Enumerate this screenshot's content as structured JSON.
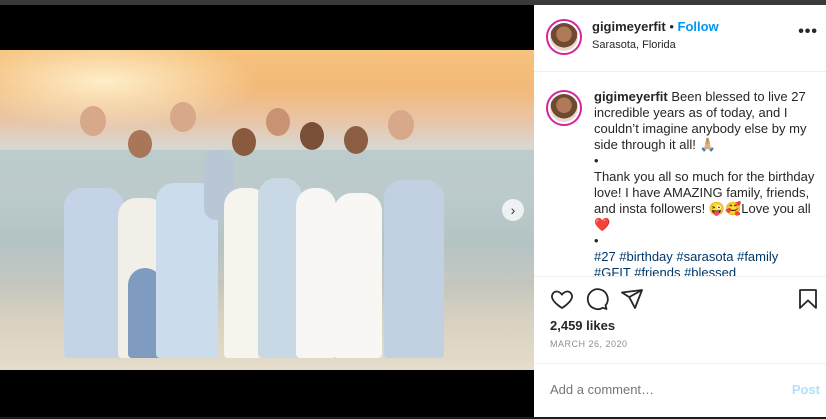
{
  "post": {
    "username": "gigimeyerfit",
    "separator": "•",
    "follow_label": "Follow",
    "location": "Sarasota, Florida",
    "more_label": "•••",
    "caption": {
      "username": "gigimeyerfit",
      "line1": "Been blessed to live 27 incredible years as of today, and I couldn’t imagine anybody else by my side through it all! 🙏🏼",
      "bullet1": "•",
      "line2": "Thank you all so much for the birthday love! I have AMAZING family, friends, and insta followers! 😜🥰Love you all ❤️",
      "bullet2": "•",
      "hashtags": "#27 #birthday #sarasota #family #GFIT #friends #blessed"
    },
    "likes": "2,459 likes",
    "date": "MARCH 26, 2020",
    "comment_placeholder": "Add a comment…",
    "post_label": "Post"
  },
  "icons": {
    "like": "heart-icon",
    "comment": "comment-icon",
    "share": "share-icon",
    "save": "bookmark-icon",
    "next": "chevron-right-icon"
  },
  "colors": {
    "accent": "#0095f6",
    "hashtag": "#00376b",
    "post_disabled": "#b2dffc",
    "story_ring": "#d6249f"
  }
}
